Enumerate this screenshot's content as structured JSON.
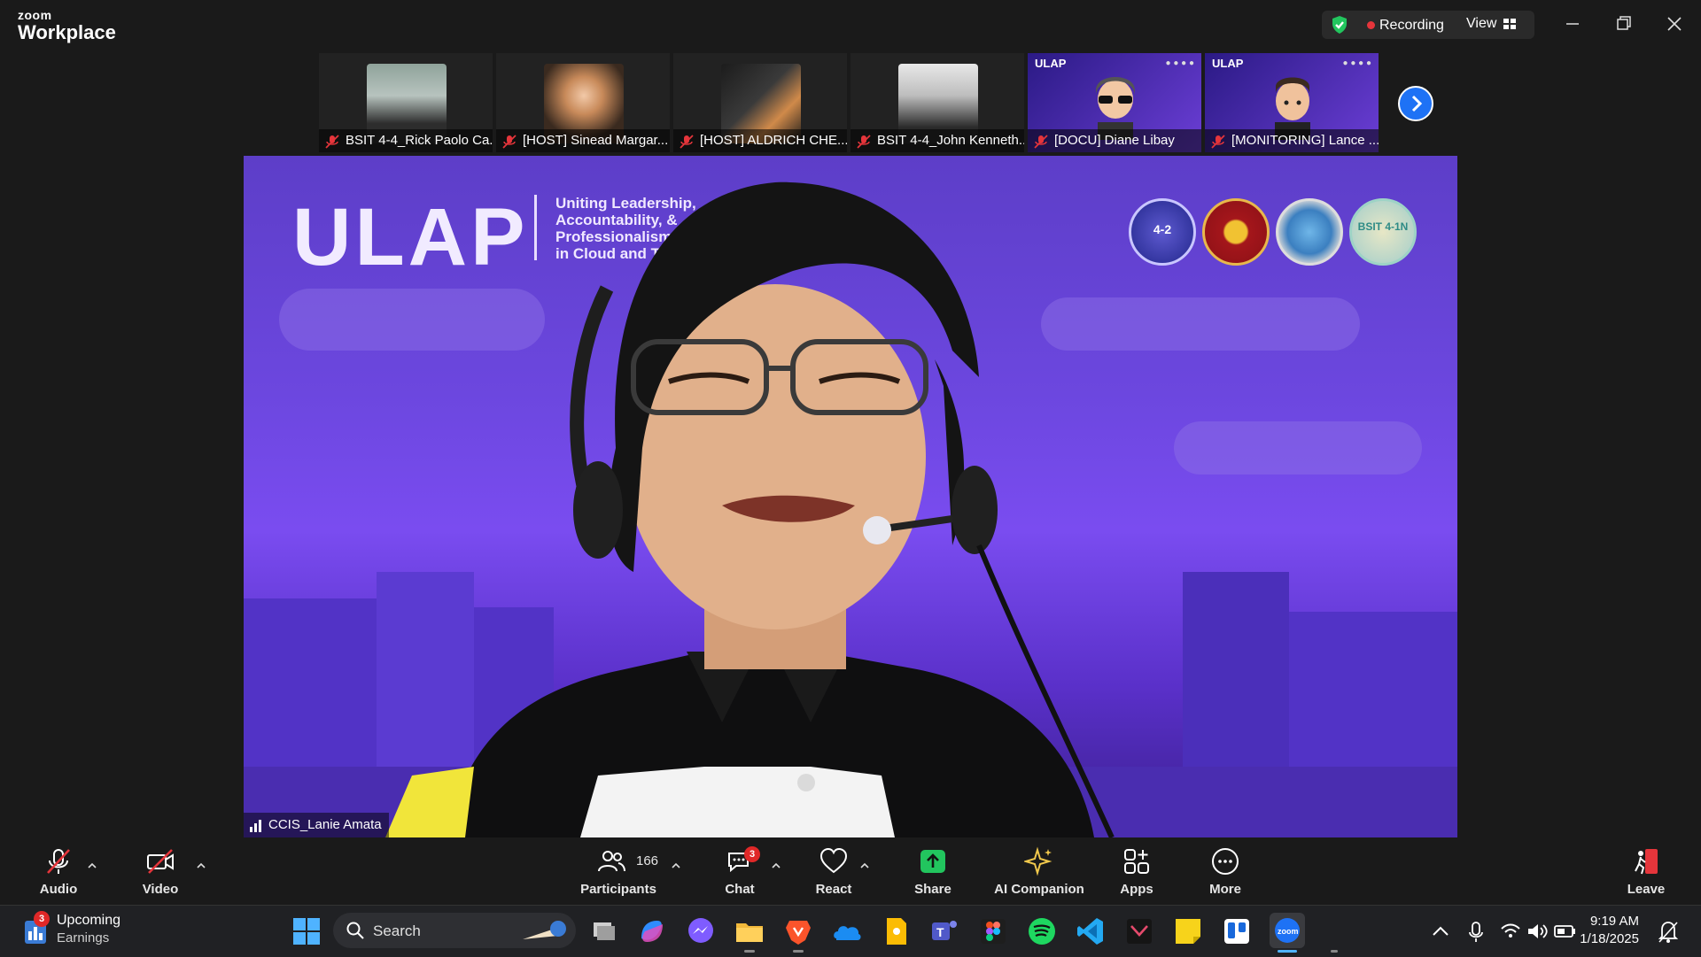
{
  "app": {
    "brand_small": "zoom",
    "brand_big": "Workplace"
  },
  "status": {
    "recording_label": "Recording",
    "view_label": "View"
  },
  "participants_strip": [
    {
      "name": "BSIT 4-4_Rick Paolo Ca..."
    },
    {
      "name": "[HOST] Sinead Margar..."
    },
    {
      "name": "[HOST] ALDRICH CHE..."
    },
    {
      "name": "BSIT 4-4_John Kenneth..."
    },
    {
      "name": "[DOCU] Diane Libay",
      "logo": "ULAP"
    },
    {
      "name": "[MONITORING] Lance ...",
      "logo": "ULAP"
    }
  ],
  "main_video": {
    "ulap_title": "ULAP",
    "tagline": [
      "Uniting Leadership,",
      "Accountability, &",
      "Professionalism",
      "in Cloud and Tech"
    ],
    "seal_labels": [
      "4-2",
      "",
      "",
      "BSIT 4-1N"
    ],
    "speaker_name": "CCIS_Lanie Amata"
  },
  "toolbar": {
    "audio": "Audio",
    "video": "Video",
    "participants": "Participants",
    "participants_count": "166",
    "chat": "Chat",
    "chat_badge": "3",
    "react": "React",
    "share": "Share",
    "ai_companion": "AI Companion",
    "apps": "Apps",
    "more": "More",
    "leave": "Leave"
  },
  "taskbar": {
    "weather_badge": "3",
    "weather_line1": "Upcoming",
    "weather_line2": "Earnings",
    "search_label": "Search",
    "time": "9:19 AM",
    "date": "1/18/2025"
  },
  "colors": {
    "accent_blue": "#1e72f5",
    "recording_red": "#e5353b",
    "share_green": "#22c55e",
    "muted_red": "#e5353b"
  }
}
